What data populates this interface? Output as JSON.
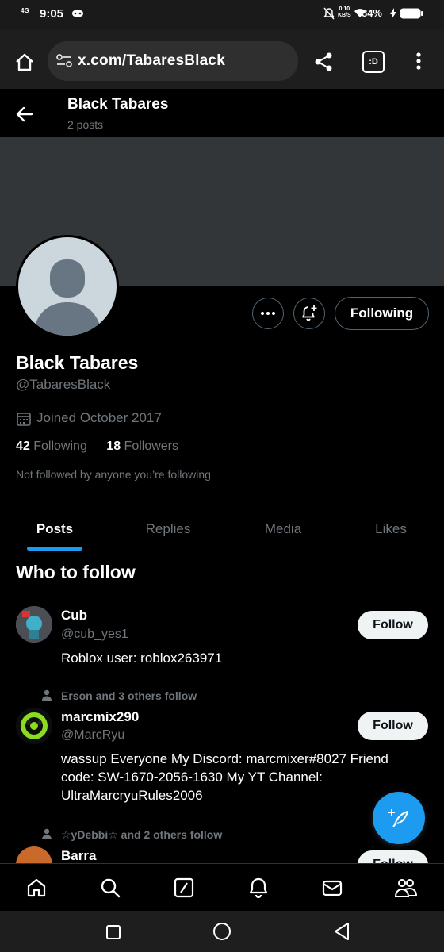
{
  "status_bar": {
    "network": "4G",
    "time": "9:05",
    "data_speed_top": "0.10",
    "data_speed_bottom": "KB/S",
    "battery": "84%"
  },
  "browser": {
    "url": "x.com/TabaresBlack",
    "tab_count_label": ":D"
  },
  "header": {
    "title": "Black Tabares",
    "post_count": "2 posts"
  },
  "profile": {
    "following_button": "Following",
    "name": "Black Tabares",
    "handle": "@TabaresBlack",
    "joined": "Joined October 2017",
    "following_count": "42",
    "following_label": "Following",
    "followers_count": "18",
    "followers_label": "Followers",
    "not_followed": "Not followed by anyone you’re following"
  },
  "tabs": [
    {
      "label": "Posts",
      "active": true
    },
    {
      "label": "Replies",
      "active": false
    },
    {
      "label": "Media",
      "active": false
    },
    {
      "label": "Likes",
      "active": false
    }
  ],
  "who_to_follow": {
    "title": "Who to follow",
    "users": [
      {
        "context": "",
        "name": "Cub",
        "handle": "@cub_yes1",
        "bio": "Roblox user: roblox263971",
        "button": "Follow"
      },
      {
        "context": "Erson and 3 others follow",
        "name": "marcmix290",
        "handle": "@MarcRyu",
        "bio": "wassup Everyone My Discord: marcmixer#8027 Friend code: SW-1670-2056-1630 My YT Channel: UltraMarcryuRules2006",
        "button": "Follow"
      },
      {
        "context": "☆yDebbi☆ and 2 others follow",
        "name": "Barra",
        "handle": "",
        "bio": "",
        "button": "Follow"
      }
    ]
  },
  "colors": {
    "accent": "#1d9bf0",
    "banner": "#333639",
    "muted_text": "#71767b"
  }
}
